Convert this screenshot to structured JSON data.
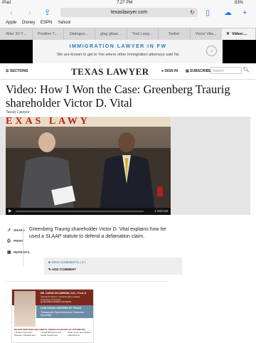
{
  "status": {
    "device": "iPad",
    "time": "7:27 PM",
    "battery": "83%"
  },
  "browser": {
    "url": "texaslawyer.com",
    "bookmarks": [
      "Apple",
      "Disney",
      "ESPN",
      "Yahoo!"
    ],
    "tabs": [
      "After 20 Y...",
      "Positive T...",
      "Dialogue...",
      "gtsg.gtlaw...",
      "Trial Lawy...",
      "Twitter",
      "Victor Vita...",
      "Video:..."
    ]
  },
  "ad": {
    "title": "IMMIGRATION LAWYER IN FW",
    "subtitle": "We are known to get to Yes where other immigration attorneys said No"
  },
  "site": {
    "sections_label": "SECTIONS",
    "logo": "TEXAS LAWYER",
    "signin_label": "SIGN IN",
    "subscribe_label": "SUBSCRIBE",
    "search_placeholder": "Search"
  },
  "article": {
    "headline": "Video: How I Won the Case: Greenberg Traurig shareholder Victor D. Vital",
    "source": "Texas Lawyer",
    "video_backdrop_text": "EXAS LAWY",
    "video_time": "1:00/3:28",
    "summary": "Greenberg Traurig shareholder Victor D. Vital explains how he used a SLAAP statute to defend a defamation claim.",
    "share_label": "SHARE",
    "print_label": "PRINT",
    "reprints_label": "REPRINTS",
    "view_comments_label": "VIEW COMMENTS ( 0 )",
    "add_comment_label": "ADD COMMENT"
  },
  "bottom_ad": {
    "doctor_name": "DR. CAROLYN CARMAN, O.D., F.A.A.O.",
    "doctor_title": "Clinical Professor, University Eye Institute, University of Houston",
    "qualified": "QUALIFIED EXPERT WITNESS",
    "center_name": "LOW VISION CENTERS OF TEXAS",
    "center_sub": "Therapeutic Optometrist and Glaucoma Specialist",
    "board": "BOARD CERTIFIED DIPLOMATE, AMERICAN BOARD OF OPTOMETRY",
    "col1": "• Ocular Injury and Disease • Medical and",
    "col2": "• Legal Blindness and Visual Impairment",
    "col3": "• Brain Injury and Strokes • Plaintiff and"
  }
}
